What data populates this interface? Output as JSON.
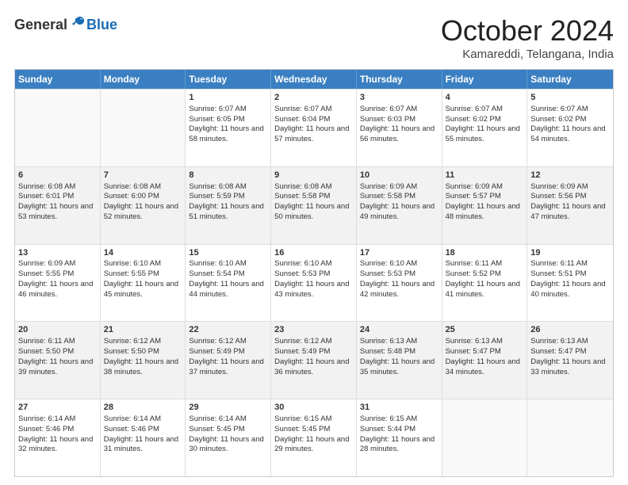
{
  "logo": {
    "general": "General",
    "blue": "Blue"
  },
  "title": "October 2024",
  "location": "Kamareddi, Telangana, India",
  "header_days": [
    "Sunday",
    "Monday",
    "Tuesday",
    "Wednesday",
    "Thursday",
    "Friday",
    "Saturday"
  ],
  "rows": [
    [
      {
        "day": "",
        "empty": true
      },
      {
        "day": "",
        "empty": true
      },
      {
        "day": "1",
        "sunrise": "Sunrise: 6:07 AM",
        "sunset": "Sunset: 6:05 PM",
        "daylight": "Daylight: 11 hours and 58 minutes."
      },
      {
        "day": "2",
        "sunrise": "Sunrise: 6:07 AM",
        "sunset": "Sunset: 6:04 PM",
        "daylight": "Daylight: 11 hours and 57 minutes."
      },
      {
        "day": "3",
        "sunrise": "Sunrise: 6:07 AM",
        "sunset": "Sunset: 6:03 PM",
        "daylight": "Daylight: 11 hours and 56 minutes."
      },
      {
        "day": "4",
        "sunrise": "Sunrise: 6:07 AM",
        "sunset": "Sunset: 6:02 PM",
        "daylight": "Daylight: 11 hours and 55 minutes."
      },
      {
        "day": "5",
        "sunrise": "Sunrise: 6:07 AM",
        "sunset": "Sunset: 6:02 PM",
        "daylight": "Daylight: 11 hours and 54 minutes."
      }
    ],
    [
      {
        "day": "6",
        "sunrise": "Sunrise: 6:08 AM",
        "sunset": "Sunset: 6:01 PM",
        "daylight": "Daylight: 11 hours and 53 minutes."
      },
      {
        "day": "7",
        "sunrise": "Sunrise: 6:08 AM",
        "sunset": "Sunset: 6:00 PM",
        "daylight": "Daylight: 11 hours and 52 minutes."
      },
      {
        "day": "8",
        "sunrise": "Sunrise: 6:08 AM",
        "sunset": "Sunset: 5:59 PM",
        "daylight": "Daylight: 11 hours and 51 minutes."
      },
      {
        "day": "9",
        "sunrise": "Sunrise: 6:08 AM",
        "sunset": "Sunset: 5:58 PM",
        "daylight": "Daylight: 11 hours and 50 minutes."
      },
      {
        "day": "10",
        "sunrise": "Sunrise: 6:09 AM",
        "sunset": "Sunset: 5:58 PM",
        "daylight": "Daylight: 11 hours and 49 minutes."
      },
      {
        "day": "11",
        "sunrise": "Sunrise: 6:09 AM",
        "sunset": "Sunset: 5:57 PM",
        "daylight": "Daylight: 11 hours and 48 minutes."
      },
      {
        "day": "12",
        "sunrise": "Sunrise: 6:09 AM",
        "sunset": "Sunset: 5:56 PM",
        "daylight": "Daylight: 11 hours and 47 minutes."
      }
    ],
    [
      {
        "day": "13",
        "sunrise": "Sunrise: 6:09 AM",
        "sunset": "Sunset: 5:55 PM",
        "daylight": "Daylight: 11 hours and 46 minutes."
      },
      {
        "day": "14",
        "sunrise": "Sunrise: 6:10 AM",
        "sunset": "Sunset: 5:55 PM",
        "daylight": "Daylight: 11 hours and 45 minutes."
      },
      {
        "day": "15",
        "sunrise": "Sunrise: 6:10 AM",
        "sunset": "Sunset: 5:54 PM",
        "daylight": "Daylight: 11 hours and 44 minutes."
      },
      {
        "day": "16",
        "sunrise": "Sunrise: 6:10 AM",
        "sunset": "Sunset: 5:53 PM",
        "daylight": "Daylight: 11 hours and 43 minutes."
      },
      {
        "day": "17",
        "sunrise": "Sunrise: 6:10 AM",
        "sunset": "Sunset: 5:53 PM",
        "daylight": "Daylight: 11 hours and 42 minutes."
      },
      {
        "day": "18",
        "sunrise": "Sunrise: 6:11 AM",
        "sunset": "Sunset: 5:52 PM",
        "daylight": "Daylight: 11 hours and 41 minutes."
      },
      {
        "day": "19",
        "sunrise": "Sunrise: 6:11 AM",
        "sunset": "Sunset: 5:51 PM",
        "daylight": "Daylight: 11 hours and 40 minutes."
      }
    ],
    [
      {
        "day": "20",
        "sunrise": "Sunrise: 6:11 AM",
        "sunset": "Sunset: 5:50 PM",
        "daylight": "Daylight: 11 hours and 39 minutes."
      },
      {
        "day": "21",
        "sunrise": "Sunrise: 6:12 AM",
        "sunset": "Sunset: 5:50 PM",
        "daylight": "Daylight: 11 hours and 38 minutes."
      },
      {
        "day": "22",
        "sunrise": "Sunrise: 6:12 AM",
        "sunset": "Sunset: 5:49 PM",
        "daylight": "Daylight: 11 hours and 37 minutes."
      },
      {
        "day": "23",
        "sunrise": "Sunrise: 6:12 AM",
        "sunset": "Sunset: 5:49 PM",
        "daylight": "Daylight: 11 hours and 36 minutes."
      },
      {
        "day": "24",
        "sunrise": "Sunrise: 6:13 AM",
        "sunset": "Sunset: 5:48 PM",
        "daylight": "Daylight: 11 hours and 35 minutes."
      },
      {
        "day": "25",
        "sunrise": "Sunrise: 6:13 AM",
        "sunset": "Sunset: 5:47 PM",
        "daylight": "Daylight: 11 hours and 34 minutes."
      },
      {
        "day": "26",
        "sunrise": "Sunrise: 6:13 AM",
        "sunset": "Sunset: 5:47 PM",
        "daylight": "Daylight: 11 hours and 33 minutes."
      }
    ],
    [
      {
        "day": "27",
        "sunrise": "Sunrise: 6:14 AM",
        "sunset": "Sunset: 5:46 PM",
        "daylight": "Daylight: 11 hours and 32 minutes."
      },
      {
        "day": "28",
        "sunrise": "Sunrise: 6:14 AM",
        "sunset": "Sunset: 5:46 PM",
        "daylight": "Daylight: 11 hours and 31 minutes."
      },
      {
        "day": "29",
        "sunrise": "Sunrise: 6:14 AM",
        "sunset": "Sunset: 5:45 PM",
        "daylight": "Daylight: 11 hours and 30 minutes."
      },
      {
        "day": "30",
        "sunrise": "Sunrise: 6:15 AM",
        "sunset": "Sunset: 5:45 PM",
        "daylight": "Daylight: 11 hours and 29 minutes."
      },
      {
        "day": "31",
        "sunrise": "Sunrise: 6:15 AM",
        "sunset": "Sunset: 5:44 PM",
        "daylight": "Daylight: 11 hours and 28 minutes."
      },
      {
        "day": "",
        "empty": true
      },
      {
        "day": "",
        "empty": true
      }
    ]
  ]
}
